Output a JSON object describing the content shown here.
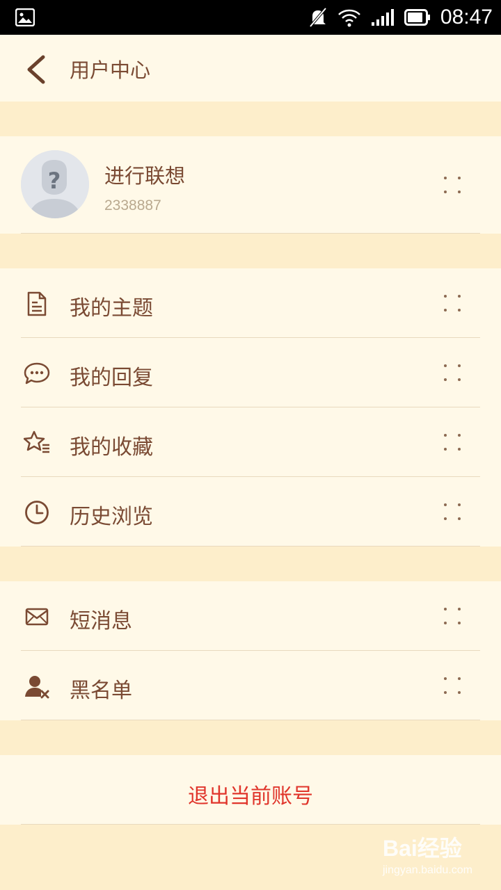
{
  "status_bar": {
    "time": "08:47"
  },
  "header": {
    "title": "用户中心"
  },
  "profile": {
    "name": "进行联想",
    "uid": "2338887"
  },
  "menu_group_1": [
    {
      "label": "我的主题",
      "icon": "document-icon"
    },
    {
      "label": "我的回复",
      "icon": "chat-bubble-icon"
    },
    {
      "label": "我的收藏",
      "icon": "star-list-icon"
    },
    {
      "label": "历史浏览",
      "icon": "clock-icon"
    }
  ],
  "menu_group_2": [
    {
      "label": "短消息",
      "icon": "envelope-icon"
    },
    {
      "label": "黑名单",
      "icon": "user-block-icon"
    }
  ],
  "logout": {
    "label": "退出当前账号"
  },
  "watermark": {
    "line1": "Bai经验",
    "line2": "jingyan.baidu.com"
  },
  "colors": {
    "background": "#FDEECB",
    "card": "#FFF9E8",
    "text": "#7A4A33",
    "logout": "#E0352B"
  }
}
